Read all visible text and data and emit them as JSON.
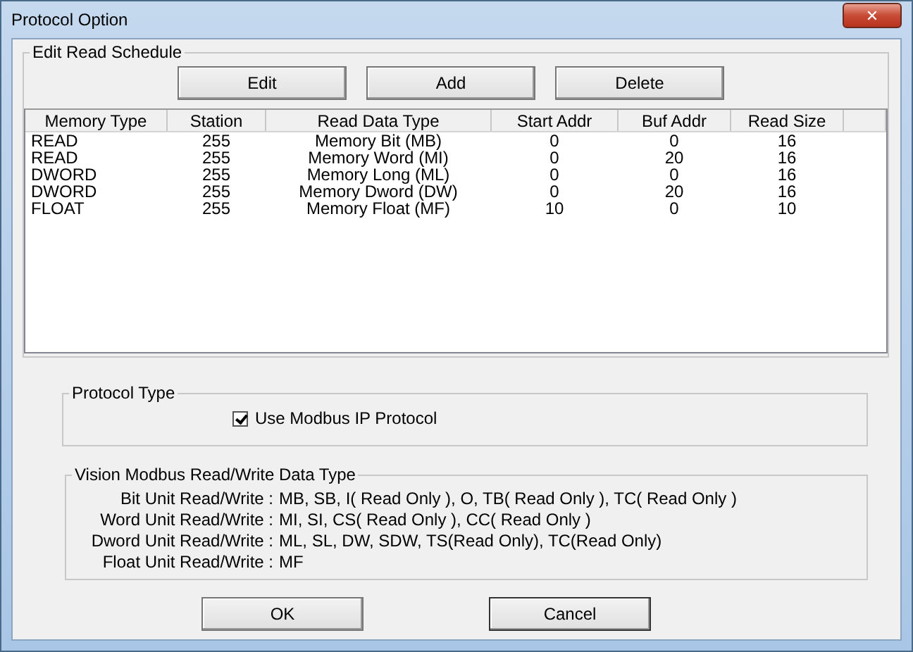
{
  "window": {
    "title": "Protocol Option",
    "close": "✕"
  },
  "schedule": {
    "title": "Edit Read Schedule",
    "buttons": [
      "Edit",
      "Add",
      "Delete"
    ],
    "columns": [
      "Memory Type",
      "Station",
      "Read Data Type",
      "Start Addr",
      "Buf Addr",
      "Read Size"
    ],
    "rows": [
      [
        "READ",
        "255",
        "Memory Bit (MB)",
        "0",
        "0",
        "16"
      ],
      [
        "READ",
        "255",
        "Memory Word (MI)",
        "0",
        "20",
        "16"
      ],
      [
        "DWORD",
        "255",
        "Memory Long (ML)",
        "0",
        "0",
        "16"
      ],
      [
        "DWORD",
        "255",
        "Memory Dword (DW)",
        "0",
        "20",
        "16"
      ],
      [
        "FLOAT",
        "255",
        "Memory Float (MF)",
        "10",
        "0",
        "10"
      ]
    ]
  },
  "protocol_type": {
    "title": "Protocol Type",
    "checkbox": {
      "label": "Use Modbus IP Protocol",
      "checked": true
    }
  },
  "data_types": {
    "title": "Vision Modbus Read/Write Data Type",
    "lines": [
      {
        "label": "Bit Unit Read/Write :",
        "value": "MB, SB, I( Read Only ), O, TB( Read Only ), TC( Read Only )"
      },
      {
        "label": "Word Unit Read/Write :",
        "value": "MI, SI, CS( Read Only ), CC( Read Only )"
      },
      {
        "label": "Dword Unit Read/Write :",
        "value": "ML, SL, DW, SDW, TS(Read Only), TC(Read Only)"
      },
      {
        "label": "Float Unit Read/Write :",
        "value": "MF"
      }
    ]
  },
  "buttons": [
    "OK",
    "Cancel"
  ]
}
